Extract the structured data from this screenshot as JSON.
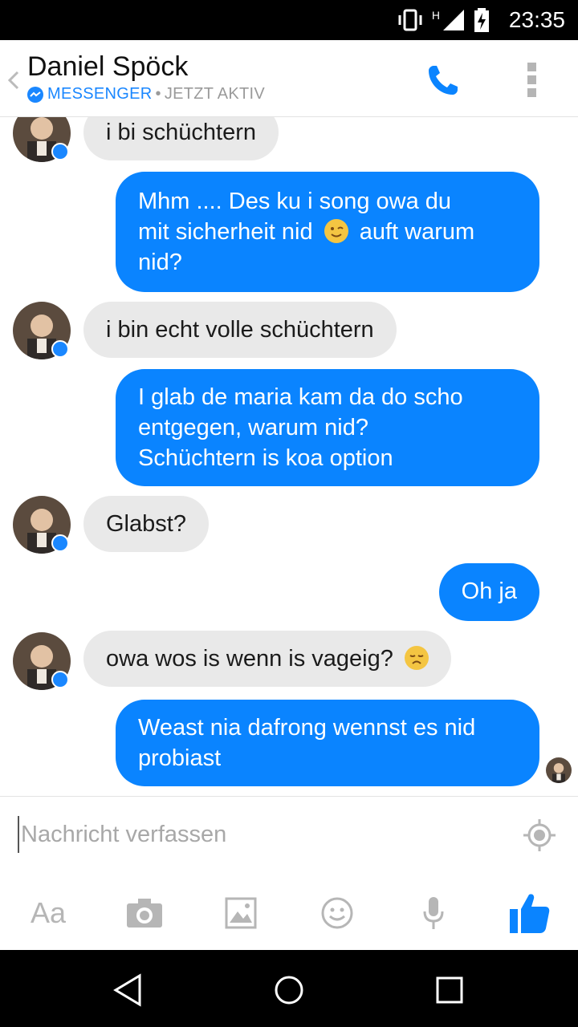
{
  "status_bar": {
    "time": "23:35",
    "network_label": "H"
  },
  "header": {
    "contact_name": "Daniel Spöck",
    "service": "MESSENGER",
    "separator": "•",
    "status": "JETZT AKTIV"
  },
  "messages": [
    {
      "from": "contact",
      "text": "i bi schüchtern"
    },
    {
      "from": "me",
      "lines": [
        "Mhm .... Des ku i song owa du",
        "mit sicherheit nid",
        "auft warum",
        "nid?"
      ],
      "emoji": "winking-face"
    },
    {
      "from": "contact",
      "text": "i bin echt volle schüchtern"
    },
    {
      "from": "me",
      "lines": [
        "I glab de maria kam da do scho",
        "entgegen, warum nid?",
        "Schüchtern is koa option"
      ]
    },
    {
      "from": "contact",
      "text": "Glabst?"
    },
    {
      "from": "me",
      "text": "Oh ja"
    },
    {
      "from": "contact",
      "text": "owa wos is wenn is vageig?",
      "emoji": "disappointed-face"
    },
    {
      "from": "me",
      "lines": [
        "Weast nia dafrong wennst es nid",
        "probiast"
      ]
    }
  ],
  "compose": {
    "placeholder": "Nachricht verfassen",
    "text_button_label": "Aa"
  },
  "colors": {
    "accent": "#0a84ff",
    "incoming_bubble": "#e9e9e9",
    "muted": "#9a9a9a"
  }
}
